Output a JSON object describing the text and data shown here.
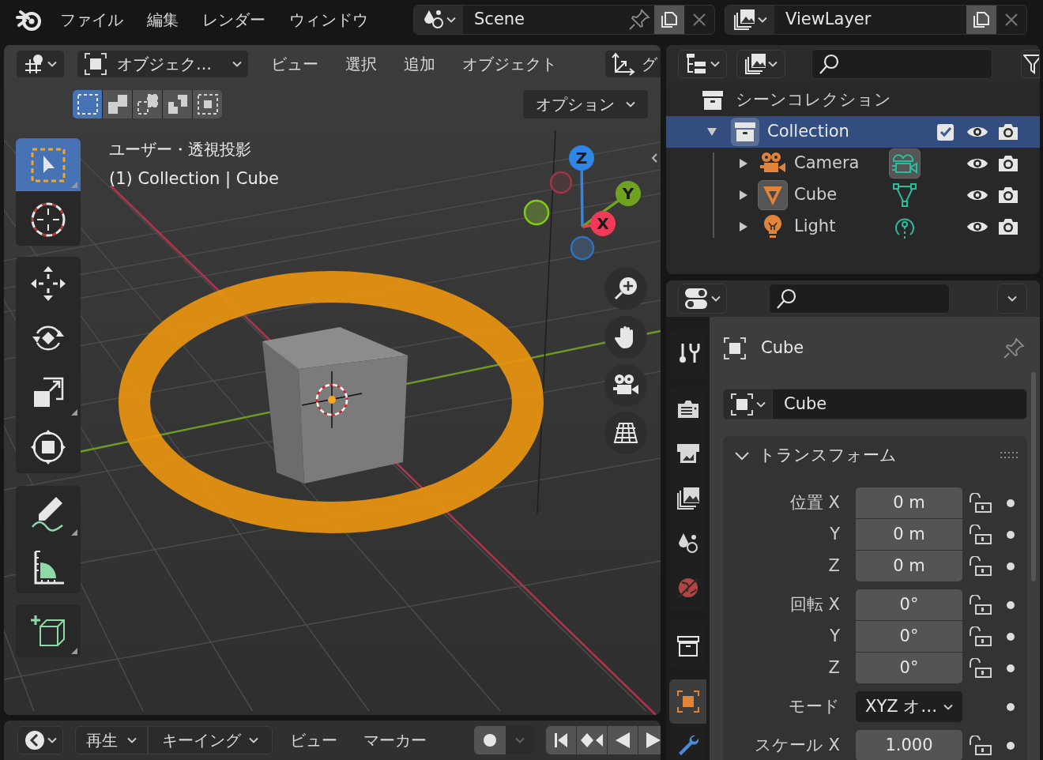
{
  "top_bar": {
    "menus": [
      "ファイル",
      "編集",
      "レンダー",
      "ウィンドウ"
    ],
    "scene": "Scene",
    "view_layer": "ViewLayer"
  },
  "viewport": {
    "header": {
      "mode": "オブジェク…",
      "menus": [
        "ビュー",
        "選択",
        "追加",
        "オブジェクト"
      ],
      "transform_label": "グ"
    },
    "select_modes": [
      {
        "kind": "set",
        "selected": true
      },
      {
        "kind": "extend",
        "selected": false
      },
      {
        "kind": "subtract",
        "selected": false
      },
      {
        "kind": "difference",
        "selected": false
      },
      {
        "kind": "intersect",
        "selected": false
      }
    ],
    "options": "オプション",
    "view_name": "ユーザー・透視投影",
    "object_info": "(1) Collection | Cube",
    "tool_groups": [
      {
        "tools": [
          {
            "kind": "select_box",
            "selected": true
          },
          {
            "kind": "cursor",
            "selected": false
          }
        ]
      },
      {
        "tools": [
          {
            "kind": "move",
            "selected": false
          },
          {
            "kind": "rotate",
            "selected": false
          },
          {
            "kind": "scale",
            "selected": false
          },
          {
            "kind": "transform",
            "selected": false
          }
        ]
      },
      {
        "tools": [
          {
            "kind": "annotate",
            "selected": false
          },
          {
            "kind": "measure",
            "selected": false
          }
        ]
      },
      {
        "tools": [
          {
            "kind": "add_cube",
            "selected": false
          }
        ]
      }
    ],
    "gizmo": [
      {
        "kind": "z",
        "label": "Z"
      },
      {
        "kind": "y",
        "label": "Y"
      },
      {
        "kind": "x",
        "label": "X"
      }
    ]
  },
  "timeline": {
    "playback": "再生",
    "keying": "キーイング",
    "menus": [
      "ビュー",
      "マーカー"
    ]
  },
  "outliner": {
    "root": "シーンコレクション",
    "items": [
      {
        "name": "Collection",
        "kind": "collection",
        "selected": true,
        "checked": true,
        "expanded": true,
        "children": [
          {
            "name": "Camera",
            "kind": "camera",
            "expanded": false,
            "active": false,
            "data_highlighted": true
          },
          {
            "name": "Cube",
            "kind": "mesh",
            "expanded": false,
            "active": true,
            "data_highlighted": false
          },
          {
            "name": "Light",
            "kind": "light",
            "expanded": false,
            "active": false,
            "data_highlighted": false
          }
        ]
      }
    ]
  },
  "properties": {
    "tabs": [
      {
        "kind": "tool",
        "selected": false
      },
      {
        "kind": "render",
        "selected": false
      },
      {
        "kind": "output",
        "selected": false
      },
      {
        "kind": "view_layer",
        "selected": false
      },
      {
        "kind": "scene",
        "selected": false
      },
      {
        "kind": "world",
        "selected": false
      },
      {
        "kind": "collection",
        "selected": false
      },
      {
        "kind": "object",
        "selected": true
      },
      {
        "kind": "modifier",
        "selected": false
      }
    ],
    "object_title": "Cube",
    "name_field": "Cube",
    "panel": {
      "title": "トランスフォーム",
      "expanded": true,
      "groups": [
        {
          "rows": [
            {
              "kind": "number",
              "label": "位置 X",
              "value": "0 m",
              "locked": false
            },
            {
              "kind": "number",
              "label": "Y",
              "value": "0 m",
              "locked": false
            },
            {
              "kind": "number",
              "label": "Z",
              "value": "0 m",
              "locked": false
            }
          ]
        },
        {
          "rows": [
            {
              "kind": "number",
              "label": "回転 X",
              "value": "0°",
              "locked": false
            },
            {
              "kind": "number",
              "label": "Y",
              "value": "0°",
              "locked": false
            },
            {
              "kind": "number",
              "label": "Z",
              "value": "0°",
              "locked": false
            }
          ]
        },
        {
          "rows": [
            {
              "kind": "dropdown",
              "label": "モード",
              "value": "XYZ オ…"
            }
          ]
        },
        {
          "rows": [
            {
              "kind": "number",
              "label": "スケール X",
              "value": "1.000",
              "locked": false
            }
          ]
        }
      ]
    }
  }
}
